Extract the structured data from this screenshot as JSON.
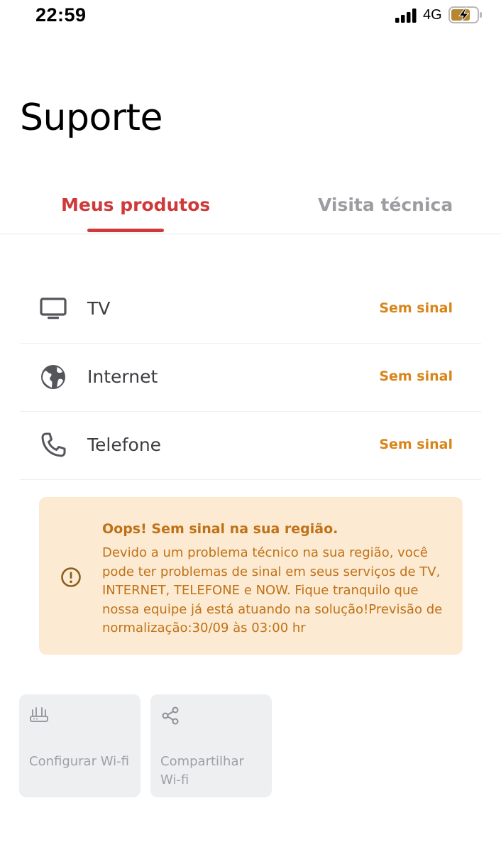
{
  "status_bar": {
    "time": "22:59",
    "network": "4G",
    "signal_icon": "signal-bars-icon",
    "battery_icon": "battery-charging-icon"
  },
  "header": {
    "title": "Suporte"
  },
  "tabs": [
    {
      "label": "Meus produtos",
      "active": true
    },
    {
      "label": "Visita técnica",
      "active": false
    }
  ],
  "products": [
    {
      "icon": "tv-icon",
      "label": "TV",
      "status": "Sem sinal"
    },
    {
      "icon": "globe-icon",
      "label": "Internet",
      "status": "Sem sinal"
    },
    {
      "icon": "phone-icon",
      "label": "Telefone",
      "status": "Sem sinal"
    }
  ],
  "alert": {
    "icon": "warning-icon",
    "title": "Oops! Sem sinal na sua região.",
    "message": "Devido a um problema técnico na sua região, você pode ter problemas de sinal em seus serviços de TV, INTERNET, TELEFONE e NOW. Fique tranquilo que nossa equipe já está atuando na solução!Previsão de normalização:30/09 às 03:00 hr"
  },
  "actions": [
    {
      "icon": "router-icon",
      "label": "Configurar Wi-fi"
    },
    {
      "icon": "share-icon",
      "label": "Compartilhar Wi-fi"
    }
  ],
  "colors": {
    "accent": "#d0393a",
    "warning": "#d8851a",
    "alert_background": "#fcebd2",
    "inactive_tab": "#9c9ca1"
  }
}
